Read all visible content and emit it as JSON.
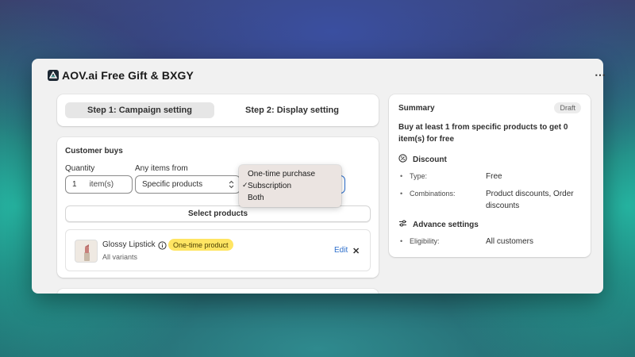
{
  "app": {
    "title": "AOV.ai Free Gift & BXGY",
    "more_glyph": "⋯"
  },
  "steps": [
    {
      "label": "Step 1: Campaign setting",
      "active": true
    },
    {
      "label": "Step 2: Display setting",
      "active": false
    }
  ],
  "customer_buys": {
    "title": "Customer buys",
    "quantity_label": "Quantity",
    "quantity_value": "1",
    "quantity_unit": "item(s)",
    "items_from_label": "Any items from",
    "items_from_value": "Specific products",
    "select_products_label": "Select products",
    "product": {
      "name": "Glossy Lipstick",
      "badge": "One-time product",
      "variants": "All variants",
      "edit_label": "Edit",
      "remove_glyph": "✕"
    }
  },
  "purchase_dropdown": {
    "options": [
      "One-time purchase",
      "Subscription",
      "Both"
    ],
    "selected": "Subscription",
    "check_glyph": "✓"
  },
  "summary": {
    "title": "Summary",
    "status": "Draft",
    "description": "Buy at least 1 from specific products to get 0 item(s) for free",
    "discount_heading": "Discount",
    "discount_rows": [
      {
        "key": "Type:",
        "value": "Free"
      },
      {
        "key": "Combinations:",
        "value": "Product discounts, Order discounts"
      }
    ],
    "advance_heading": "Advance settings",
    "advance_rows": [
      {
        "key": "Eligibility:",
        "value": "All customers"
      }
    ]
  },
  "colors": {
    "accent": "#2c6ecb",
    "badge_yellow": "#ffe563",
    "dropdown_bg": "#ebe4e1"
  },
  "icons": [
    "app-logo-icon",
    "more-icon",
    "chevron-updown-icon",
    "info-icon",
    "close-icon",
    "discount-icon",
    "sliders-icon",
    "check-icon"
  ]
}
